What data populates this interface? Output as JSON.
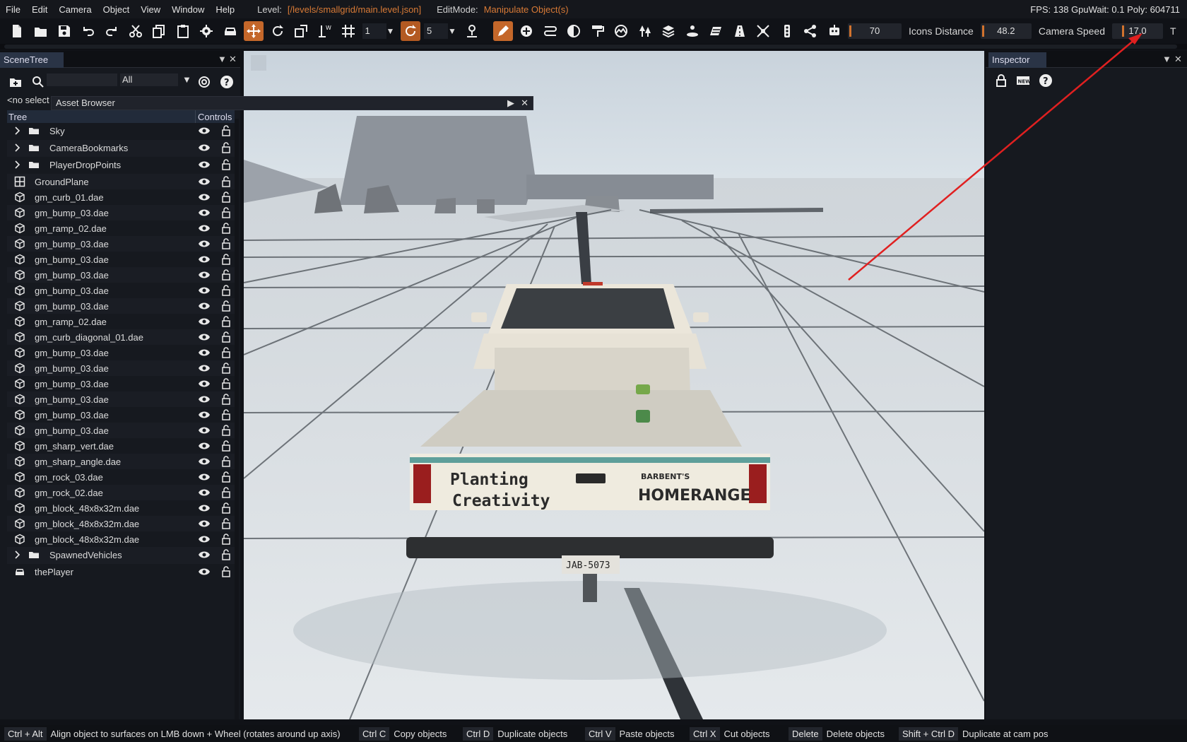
{
  "menu": {
    "items": [
      "File",
      "Edit",
      "Camera",
      "Object",
      "View",
      "Window",
      "Help"
    ],
    "level_label": "Level:",
    "level_value": "[/levels/smallgrid/main.level.json]",
    "editmode_label": "EditMode:",
    "editmode_value": "Manipulate Object(s)",
    "stats": "FPS: 138  GpuWait: 0.1  Poly: 604711"
  },
  "toolbar": {
    "grid_size": "1",
    "snap_value": "5",
    "slider_1": "70",
    "icons_distance_label": "Icons Distance",
    "icons_distance": "48.2",
    "camera_speed_label": "Camera Speed",
    "camera_speed": "17.0",
    "trailing": "T"
  },
  "scenetree": {
    "title": "SceneTree",
    "filter": "All",
    "no_selection": "<no selection>",
    "asset_browser": "Asset Browser",
    "col_tree": "Tree",
    "col_controls": "Controls",
    "items": [
      {
        "name": "Sky",
        "icon": "folder-icon",
        "expandable": true
      },
      {
        "name": "CameraBookmarks",
        "icon": "folder-icon",
        "expandable": true
      },
      {
        "name": "PlayerDropPoints",
        "icon": "folder-icon",
        "expandable": true
      },
      {
        "name": "GroundPlane",
        "icon": "grid-icon",
        "expandable": false
      },
      {
        "name": "gm_curb_01.dae",
        "icon": "cube-icon",
        "expandable": false
      },
      {
        "name": "gm_bump_03.dae",
        "icon": "cube-icon",
        "expandable": false
      },
      {
        "name": "gm_ramp_02.dae",
        "icon": "cube-icon",
        "expandable": false
      },
      {
        "name": "gm_bump_03.dae",
        "icon": "cube-icon",
        "expandable": false
      },
      {
        "name": "gm_bump_03.dae",
        "icon": "cube-icon",
        "expandable": false
      },
      {
        "name": "gm_bump_03.dae",
        "icon": "cube-icon",
        "expandable": false
      },
      {
        "name": "gm_bump_03.dae",
        "icon": "cube-icon",
        "expandable": false
      },
      {
        "name": "gm_bump_03.dae",
        "icon": "cube-icon",
        "expandable": false
      },
      {
        "name": "gm_ramp_02.dae",
        "icon": "cube-icon",
        "expandable": false
      },
      {
        "name": "gm_curb_diagonal_01.dae",
        "icon": "cube-icon",
        "expandable": false
      },
      {
        "name": "gm_bump_03.dae",
        "icon": "cube-icon",
        "expandable": false
      },
      {
        "name": "gm_bump_03.dae",
        "icon": "cube-icon",
        "expandable": false
      },
      {
        "name": "gm_bump_03.dae",
        "icon": "cube-icon",
        "expandable": false
      },
      {
        "name": "gm_bump_03.dae",
        "icon": "cube-icon",
        "expandable": false
      },
      {
        "name": "gm_bump_03.dae",
        "icon": "cube-icon",
        "expandable": false
      },
      {
        "name": "gm_bump_03.dae",
        "icon": "cube-icon",
        "expandable": false
      },
      {
        "name": "gm_sharp_vert.dae",
        "icon": "cube-icon",
        "expandable": false
      },
      {
        "name": "gm_sharp_angle.dae",
        "icon": "cube-icon",
        "expandable": false
      },
      {
        "name": "gm_rock_03.dae",
        "icon": "cube-icon",
        "expandable": false
      },
      {
        "name": "gm_rock_02.dae",
        "icon": "cube-icon",
        "expandable": false
      },
      {
        "name": "gm_block_48x8x32m.dae",
        "icon": "cube-icon",
        "expandable": false
      },
      {
        "name": "gm_block_48x8x32m.dae",
        "icon": "cube-icon",
        "expandable": false
      },
      {
        "name": "gm_block_48x8x32m.dae",
        "icon": "cube-icon",
        "expandable": false
      },
      {
        "name": "SpawnedVehicles",
        "icon": "folder-icon",
        "expandable": true
      },
      {
        "name": "thePlayer",
        "icon": "car-icon",
        "expandable": false
      }
    ]
  },
  "inspector": {
    "title": "Inspector",
    "new_label": "NEW"
  },
  "viewport": {
    "truck_text_1": "Planting",
    "truck_text_2": "Creativity",
    "brand_top": "BARBENT'S",
    "brand_main": "HOMERANGE",
    "plate": "JAB-5073"
  },
  "statusbar": [
    {
      "key": "Ctrl + Alt",
      "desc": "Align object to surfaces on LMB down + Wheel (rotates around up axis)"
    },
    {
      "key": "Ctrl C",
      "desc": "Copy objects"
    },
    {
      "key": "Ctrl D",
      "desc": "Duplicate objects"
    },
    {
      "key": "Ctrl V",
      "desc": "Paste objects"
    },
    {
      "key": "Ctrl X",
      "desc": "Cut objects"
    },
    {
      "key": "Delete",
      "desc": "Delete objects"
    },
    {
      "key": "Shift + Ctrl D",
      "desc": "Duplicate at cam pos"
    }
  ],
  "colors": {
    "accent": "#d87a36",
    "annotation_arrow": "#e02020",
    "panel_tab": "#2a3446"
  }
}
